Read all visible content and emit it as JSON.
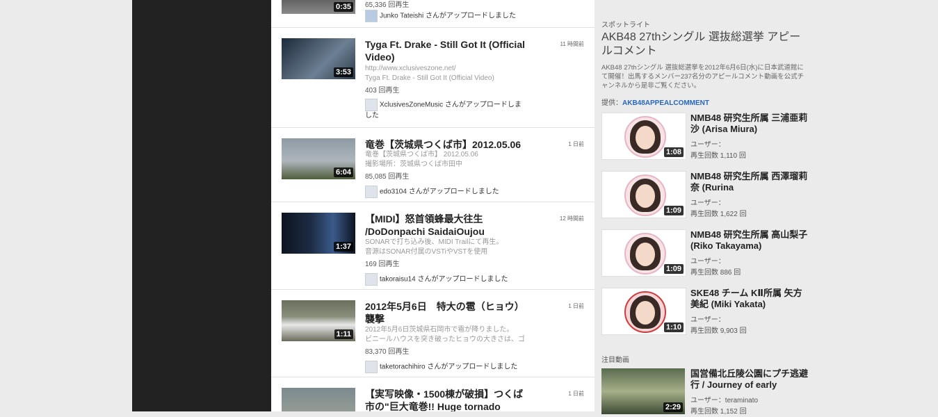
{
  "feed": [
    {
      "title": "",
      "time": "",
      "desc": [],
      "views": "65,336 回再生",
      "uploader": "Junko Tateishi さんがアップロードしました",
      "duration": "0:35",
      "thumb_colors": [
        "#3b3b3b",
        "#8a8a8a"
      ]
    },
    {
      "title": "Tyga Ft. Drake - Still Got It (Official Video)",
      "time": "11 時間前",
      "desc": [
        "http://www.xclusiveszone.net/",
        "Tyga Ft. Drake - Still Got It (Official Video)"
      ],
      "views": "403 回再生",
      "uploader": "XclusivesZoneMusic さんがアップロードしました",
      "duration": "3:53",
      "thumb_colors": [
        "#1c2a3a",
        "#6d7f93"
      ]
    },
    {
      "title": "竜巻【茨城県つくば市】2012.05.06",
      "time": "1 日前",
      "desc": [
        "竜巻【茨城県つくば市】 2012.05.06",
        "撮影場所：茨城県つくば市田中"
      ],
      "views": "85,085 回再生",
      "uploader": "edo3104 さんがアップロードしました",
      "duration": "6:04",
      "thumb_colors": [
        "#8e9aa4",
        "#4f5d3c"
      ]
    },
    {
      "title": "【MIDI】怒首領蜂最大往生 /DoDonpachi SaidaiOujou",
      "time": "12 時間前",
      "desc": [
        "SONARで打ち込み後、MIDI Trailにて再生。",
        "音源はSONAR付属のVSTiやVSTを使用"
      ],
      "views": "169 回再生",
      "uploader": "takoraisu14 さんがアップロードしました",
      "duration": "1:37",
      "thumb_colors": [
        "#0d1420",
        "#3b5a8a"
      ]
    },
    {
      "title": "2012年5月6日　特大の雹（ヒョウ）襲撃",
      "time": "1 日前",
      "desc": [
        "2012年5月6日茨城県石岡市で雹が降りました。",
        "ビニールハウスを突き破ったヒョウの大きさは、ゴ"
      ],
      "views": "83,370 回再生",
      "uploader": "taketorachihiro さんがアップロードしました",
      "duration": "1:11",
      "thumb_colors": [
        "#6a6f5e",
        "#e8e8e8"
      ]
    },
    {
      "title": "【実写映像・1500棟が破損】つくば市の\"巨大竜巻!! Huge tornado",
      "time": "1 日前",
      "desc": [],
      "views": "",
      "uploader": "",
      "duration": "",
      "thumb_colors": [
        "#7c8a8f",
        "#a4a89a"
      ]
    }
  ],
  "spotlight": {
    "label": "スポットライト",
    "title": "AKB48 27thシングル 選抜総選挙 アピールコメント",
    "desc": "AKB48 27thシングル 選抜総選挙を2012年6月6日(水)に日本武道館にて開催！出馬するメンバー237名分のアピールコメント動画を公式チャンネルから是非ご覧ください。",
    "provider_label": "提供：",
    "provider_link": "AKB48APPEALCOMMENT",
    "items": [
      {
        "title": "NMB48 研究生所属 三浦亜莉沙 (Arisa Miura)",
        "user": "ユーザー：",
        "views": "再生回数 1,110 回",
        "duration": "1:08",
        "accent": "#e9b5c3"
      },
      {
        "title": "NMB48 研究生所属 西澤瑠莉奈 (Rurina",
        "user": "ユーザー：",
        "views": "再生回数 1,622 回",
        "duration": "1:09",
        "accent": "#e9b5c3"
      },
      {
        "title": "NMB48 研究生所属 高山梨子 (Riko Takayama)",
        "user": "ユーザー：",
        "views": "再生回数 886 回",
        "duration": "1:09",
        "accent": "#e9b5c3"
      },
      {
        "title": "SKE48 チーム KⅡ所属 矢方美紀 (Miki Yakata)",
        "user": "ユーザー：",
        "views": "再生回数 9,903 回",
        "duration": "1:10",
        "accent": "#d43a3a"
      }
    ]
  },
  "featured": {
    "label": "注目動画",
    "items": [
      {
        "title": "国営備北丘陵公園にプチ逃避行 / Journey of early",
        "user": "ユーザー：teraminato",
        "views": "再生回数 1,152 回",
        "duration": "2:29"
      }
    ]
  }
}
